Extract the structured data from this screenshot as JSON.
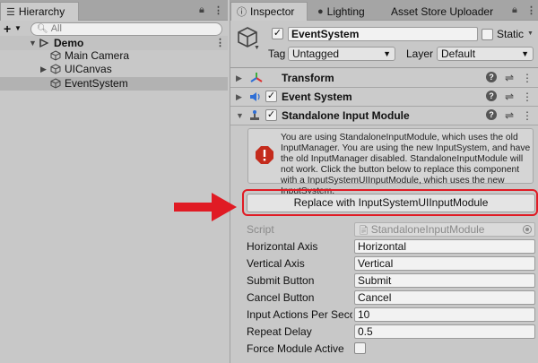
{
  "hierarchy": {
    "tab_label": "Hierarchy",
    "search_placeholder": "All",
    "scene_name": "Demo",
    "items": [
      {
        "label": "Main Camera"
      },
      {
        "label": "UICanvas"
      },
      {
        "label": "EventSystem"
      }
    ]
  },
  "inspector": {
    "tabs": [
      {
        "label": "Inspector",
        "icon": "info-icon"
      },
      {
        "label": "Lighting",
        "icon": "bulb-icon"
      },
      {
        "label": "Asset Store Uploader"
      }
    ],
    "gameobject": {
      "name": "EventSystem",
      "active": true,
      "static_label": "Static",
      "static": false,
      "tag_label": "Tag",
      "tag_value": "Untagged",
      "layer_label": "Layer",
      "layer_value": "Default"
    },
    "components": [
      {
        "title": "Transform",
        "icon": "transform-icon"
      },
      {
        "title": "Event System",
        "icon": "event-system-icon",
        "enabled": true
      },
      {
        "title": "Standalone Input Module",
        "icon": "input-module-icon",
        "enabled": true
      }
    ],
    "help_message": "You are using StandaloneInputModule, which uses the old InputManager. You are using the new InputSystem, and have the old InputManager disabled. StandaloneInputModule will not work. Click the button below to replace this component with a InputSystemUIInputModule, which uses the new InputSystem.",
    "replace_button": "Replace with InputSystemUIInputModule",
    "properties": [
      {
        "label": "Script",
        "value": "StandaloneInputModule"
      },
      {
        "label": "Horizontal Axis",
        "value": "Horizontal"
      },
      {
        "label": "Vertical Axis",
        "value": "Vertical"
      },
      {
        "label": "Submit Button",
        "value": "Submit"
      },
      {
        "label": "Cancel Button",
        "value": "Cancel"
      },
      {
        "label": "Input Actions Per Second",
        "value": "10"
      },
      {
        "label": "Repeat Delay",
        "value": "0.5"
      },
      {
        "label": "Force Module Active",
        "value": false
      }
    ]
  },
  "colors": {
    "highlight": "#e01b24",
    "error": "#c42b1c",
    "panel": "#c8c8c8"
  }
}
